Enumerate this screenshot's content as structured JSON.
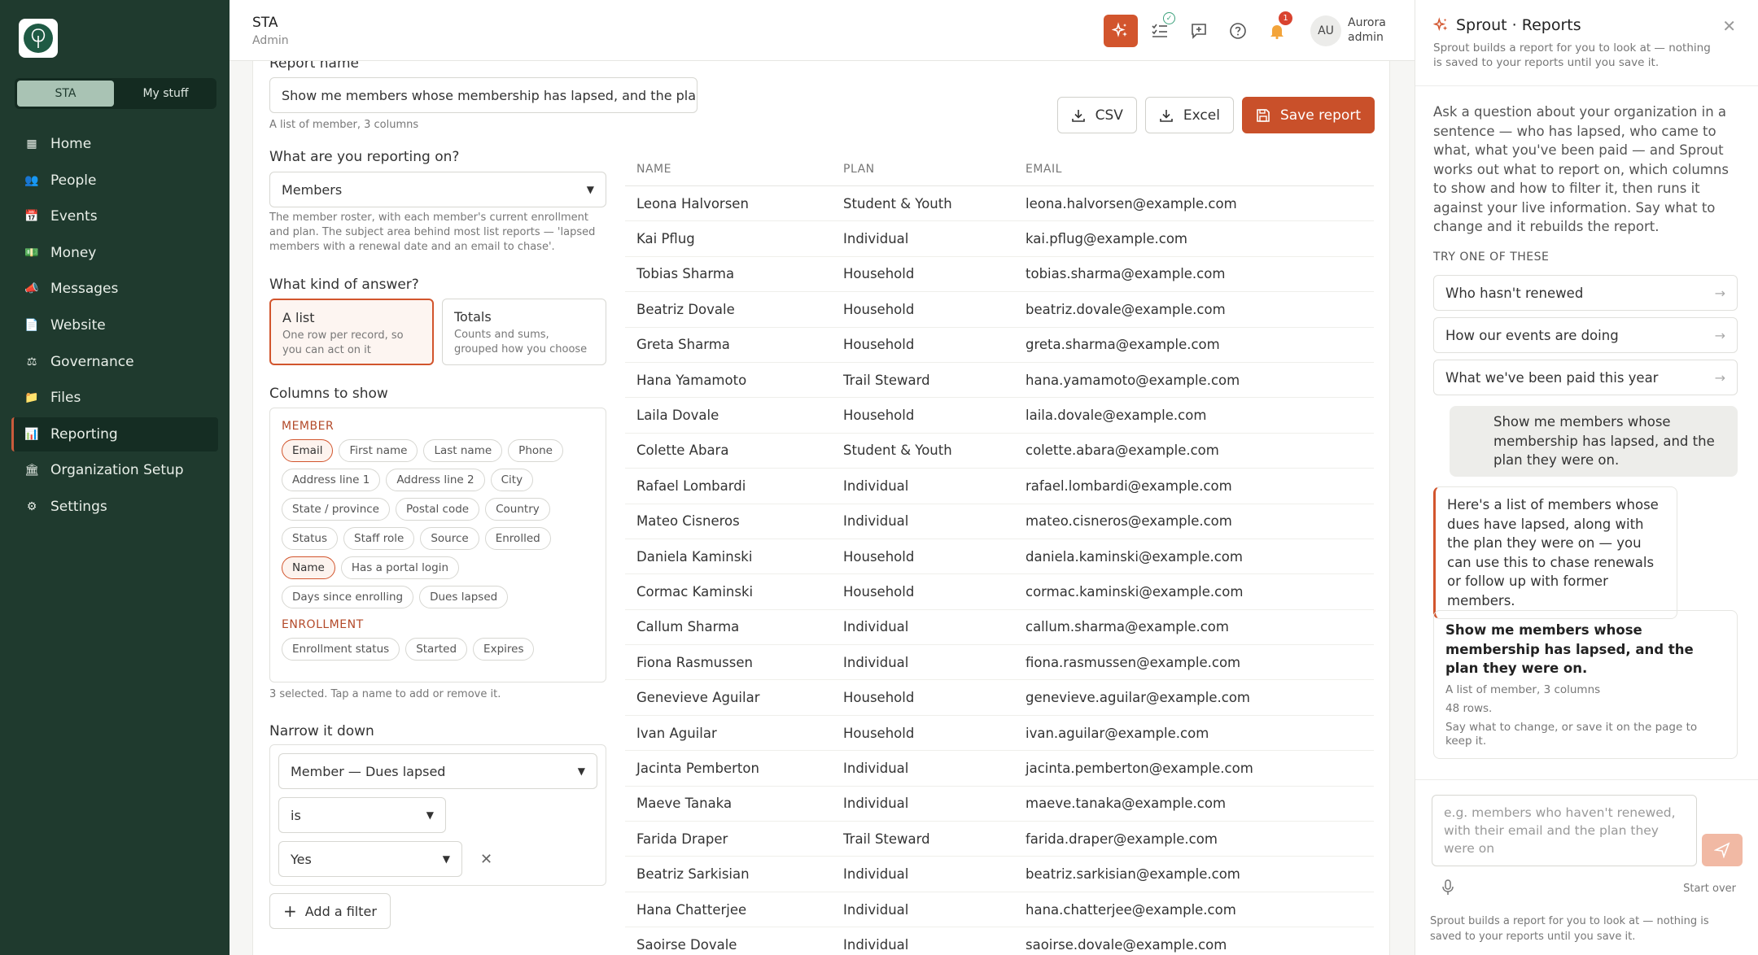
{
  "sidebar": {
    "switcher": [
      "STA",
      "My stuff"
    ],
    "items": [
      {
        "label": "Home",
        "icon": "home-icon",
        "glyph": "▦"
      },
      {
        "label": "People",
        "icon": "people-icon",
        "glyph": "👥"
      },
      {
        "label": "Events",
        "icon": "calendar-icon",
        "glyph": "📅"
      },
      {
        "label": "Money",
        "icon": "money-icon",
        "glyph": "💵"
      },
      {
        "label": "Messages",
        "icon": "megaphone-icon",
        "glyph": "📣"
      },
      {
        "label": "Website",
        "icon": "page-icon",
        "glyph": "📄"
      },
      {
        "label": "Governance",
        "icon": "governance-icon",
        "glyph": "⚖"
      },
      {
        "label": "Files",
        "icon": "folder-icon",
        "glyph": "📁"
      },
      {
        "label": "Reporting",
        "icon": "chart-icon",
        "glyph": "📊"
      },
      {
        "label": "Organization Setup",
        "icon": "building-icon",
        "glyph": "🏛"
      },
      {
        "label": "Settings",
        "icon": "gear-icon",
        "glyph": "⚙"
      }
    ],
    "active": "Reporting"
  },
  "topbar": {
    "org_name": "STA",
    "org_role": "Admin",
    "notification_count": "1",
    "avatar_initials": "AU",
    "user_name": "Aurora",
    "user_role": "admin"
  },
  "form": {
    "report_name_label": "Report name",
    "report_name_value": "Show me members whose membership has lapsed, and the plan th",
    "report_name_hint": "A list of member, 3 columns",
    "subject_label": "What are you reporting on?",
    "subject_value": "Members",
    "subject_hint": "The member roster, with each member's current enrollment and plan. The subject area behind most list reports — 'lapsed members with a renewal date and an email to chase'.",
    "answer_label": "What kind of answer?",
    "answer_list_title": "A list",
    "answer_list_desc": "One row per record, so you can act on it",
    "answer_totals_title": "Totals",
    "answer_totals_desc": "Counts and sums, grouped how you choose",
    "columns_label": "Columns to show",
    "member_group": "MEMBER",
    "member_chips": [
      {
        "label": "Email",
        "on": true
      },
      {
        "label": "First name",
        "on": false
      },
      {
        "label": "Last name",
        "on": false
      },
      {
        "label": "Phone",
        "on": false
      },
      {
        "label": "Address line 1",
        "on": false
      },
      {
        "label": "Address line 2",
        "on": false
      },
      {
        "label": "City",
        "on": false
      },
      {
        "label": "State / province",
        "on": false
      },
      {
        "label": "Postal code",
        "on": false
      },
      {
        "label": "Country",
        "on": false
      },
      {
        "label": "Status",
        "on": false
      },
      {
        "label": "Staff role",
        "on": false
      },
      {
        "label": "Source",
        "on": false
      },
      {
        "label": "Enrolled",
        "on": false
      },
      {
        "label": "Name",
        "on": true
      },
      {
        "label": "Has a portal login",
        "on": false
      },
      {
        "label": "Days since enrolling",
        "on": false
      },
      {
        "label": "Dues lapsed",
        "on": false
      }
    ],
    "enrollment_group": "ENROLLMENT",
    "enrollment_chips": [
      {
        "label": "Enrollment status",
        "on": false
      },
      {
        "label": "Started",
        "on": false
      },
      {
        "label": "Expires",
        "on": false
      }
    ],
    "columns_hint": "3 selected. Tap a name to add or remove it.",
    "narrow_label": "Narrow it down",
    "filter_field": "Member — Dues lapsed",
    "filter_op": "is",
    "filter_value": "Yes",
    "add_filter": "Add a filter"
  },
  "actions": {
    "csv": "CSV",
    "excel": "Excel",
    "save": "Save report"
  },
  "table": {
    "headers": [
      "NAME",
      "PLAN",
      "EMAIL"
    ],
    "rows": [
      [
        "Leona Halvorsen",
        "Student & Youth",
        "leona.halvorsen@example.com"
      ],
      [
        "Kai Pflug",
        "Individual",
        "kai.pflug@example.com"
      ],
      [
        "Tobias Sharma",
        "Household",
        "tobias.sharma@example.com"
      ],
      [
        "Beatriz Dovale",
        "Household",
        "beatriz.dovale@example.com"
      ],
      [
        "Greta Sharma",
        "Household",
        "greta.sharma@example.com"
      ],
      [
        "Hana Yamamoto",
        "Trail Steward",
        "hana.yamamoto@example.com"
      ],
      [
        "Laila Dovale",
        "Household",
        "laila.dovale@example.com"
      ],
      [
        "Colette Abara",
        "Student & Youth",
        "colette.abara@example.com"
      ],
      [
        "Rafael Lombardi",
        "Individual",
        "rafael.lombardi@example.com"
      ],
      [
        "Mateo Cisneros",
        "Individual",
        "mateo.cisneros@example.com"
      ],
      [
        "Daniela Kaminski",
        "Household",
        "daniela.kaminski@example.com"
      ],
      [
        "Cormac Kaminski",
        "Household",
        "cormac.kaminski@example.com"
      ],
      [
        "Callum Sharma",
        "Individual",
        "callum.sharma@example.com"
      ],
      [
        "Fiona Rasmussen",
        "Individual",
        "fiona.rasmussen@example.com"
      ],
      [
        "Genevieve Aguilar",
        "Household",
        "genevieve.aguilar@example.com"
      ],
      [
        "Ivan Aguilar",
        "Household",
        "ivan.aguilar@example.com"
      ],
      [
        "Jacinta Pemberton",
        "Individual",
        "jacinta.pemberton@example.com"
      ],
      [
        "Maeve Tanaka",
        "Individual",
        "maeve.tanaka@example.com"
      ],
      [
        "Farida Draper",
        "Trail Steward",
        "farida.draper@example.com"
      ],
      [
        "Beatriz Sarkisian",
        "Individual",
        "beatriz.sarkisian@example.com"
      ],
      [
        "Hana Chatterjee",
        "Individual",
        "hana.chatterjee@example.com"
      ],
      [
        "Saoirse Dovale",
        "Individual",
        "saoirse.dovale@example.com"
      ]
    ]
  },
  "panel": {
    "title": "Sprout · Reports",
    "subtitle": "Sprout builds a report for you to look at — nothing is saved to your reports until you save it.",
    "intro": "Ask a question about your organization in a sentence — who has lapsed, who came to what, what you've been paid — and Sprout works out what to report on, which columns to show and how to filter it, then runs it against your live information. Say what to change and it rebuilds the report.",
    "try_label": "TRY ONE OF THESE",
    "suggestions": [
      "Who hasn't renewed",
      "How our events are doing",
      "What we've been paid this year"
    ],
    "user_message": "Show me members whose membership has lapsed, and the plan they were on.",
    "bot_message": "Here's a list of members whose dues have lapsed, along with the plan they were on — you can use this to chase renewals or follow up with former members.",
    "result_title": "Show me members whose membership has lapsed, and the plan they were on.",
    "result_meta1": "A list of member, 3 columns",
    "result_meta2": "48 rows.",
    "result_meta3": "Say what to change, or save it on the page to keep it.",
    "compose_placeholder": "e.g. members who haven't renewed, with their email and the plan they were on",
    "start_over": "Start over",
    "footer_note": "Sprout builds a report for you to look at — nothing is saved to your reports until you save it."
  },
  "colors": {
    "accent": "#d2552d",
    "sidebar": "#1f3a2e",
    "primary_button": "#c9502a"
  }
}
